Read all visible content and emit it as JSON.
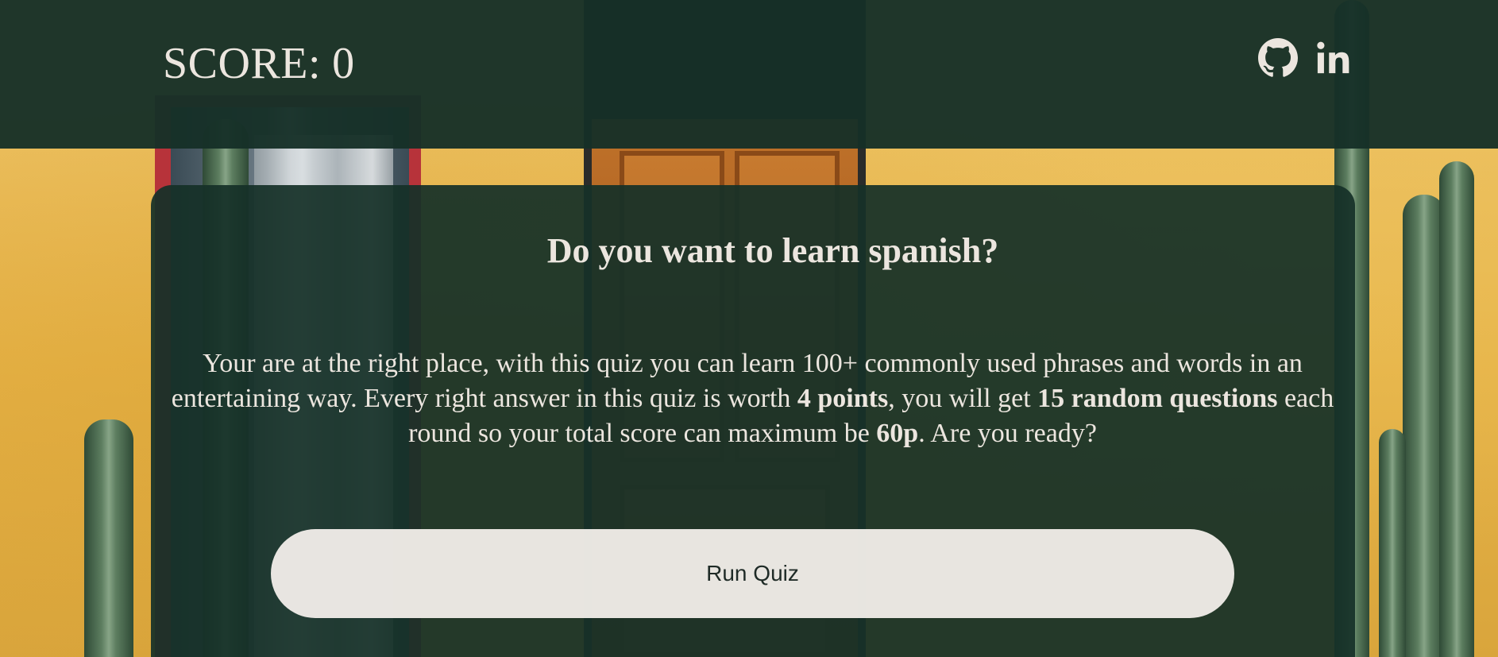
{
  "header": {
    "score_label": "SCORE:",
    "score_value": "0",
    "links": [
      {
        "icon": "github-icon",
        "label": "GitHub"
      },
      {
        "icon": "linkedin-icon",
        "label": "LinkedIn"
      }
    ]
  },
  "intro": {
    "title": "Do you want to learn spanish?",
    "text_part1": "Your are at the right place, with this quiz you can learn 100+ commonly used phrases and words in an entertaining way. Every right answer in this quiz is worth ",
    "bold1": "4 points",
    "text_part2": ", you will get ",
    "bold2": "15 random questions",
    "text_part3": " each round so your total score can maximum be ",
    "bold3": "60p",
    "text_part4": ". Are you ready?",
    "button_label": "Run Quiz"
  },
  "colors": {
    "overlay": "#163028",
    "text": "#ece6df",
    "button_bg": "#f0ece8",
    "button_text": "#1f2b27",
    "wall": "#e8b94d"
  }
}
